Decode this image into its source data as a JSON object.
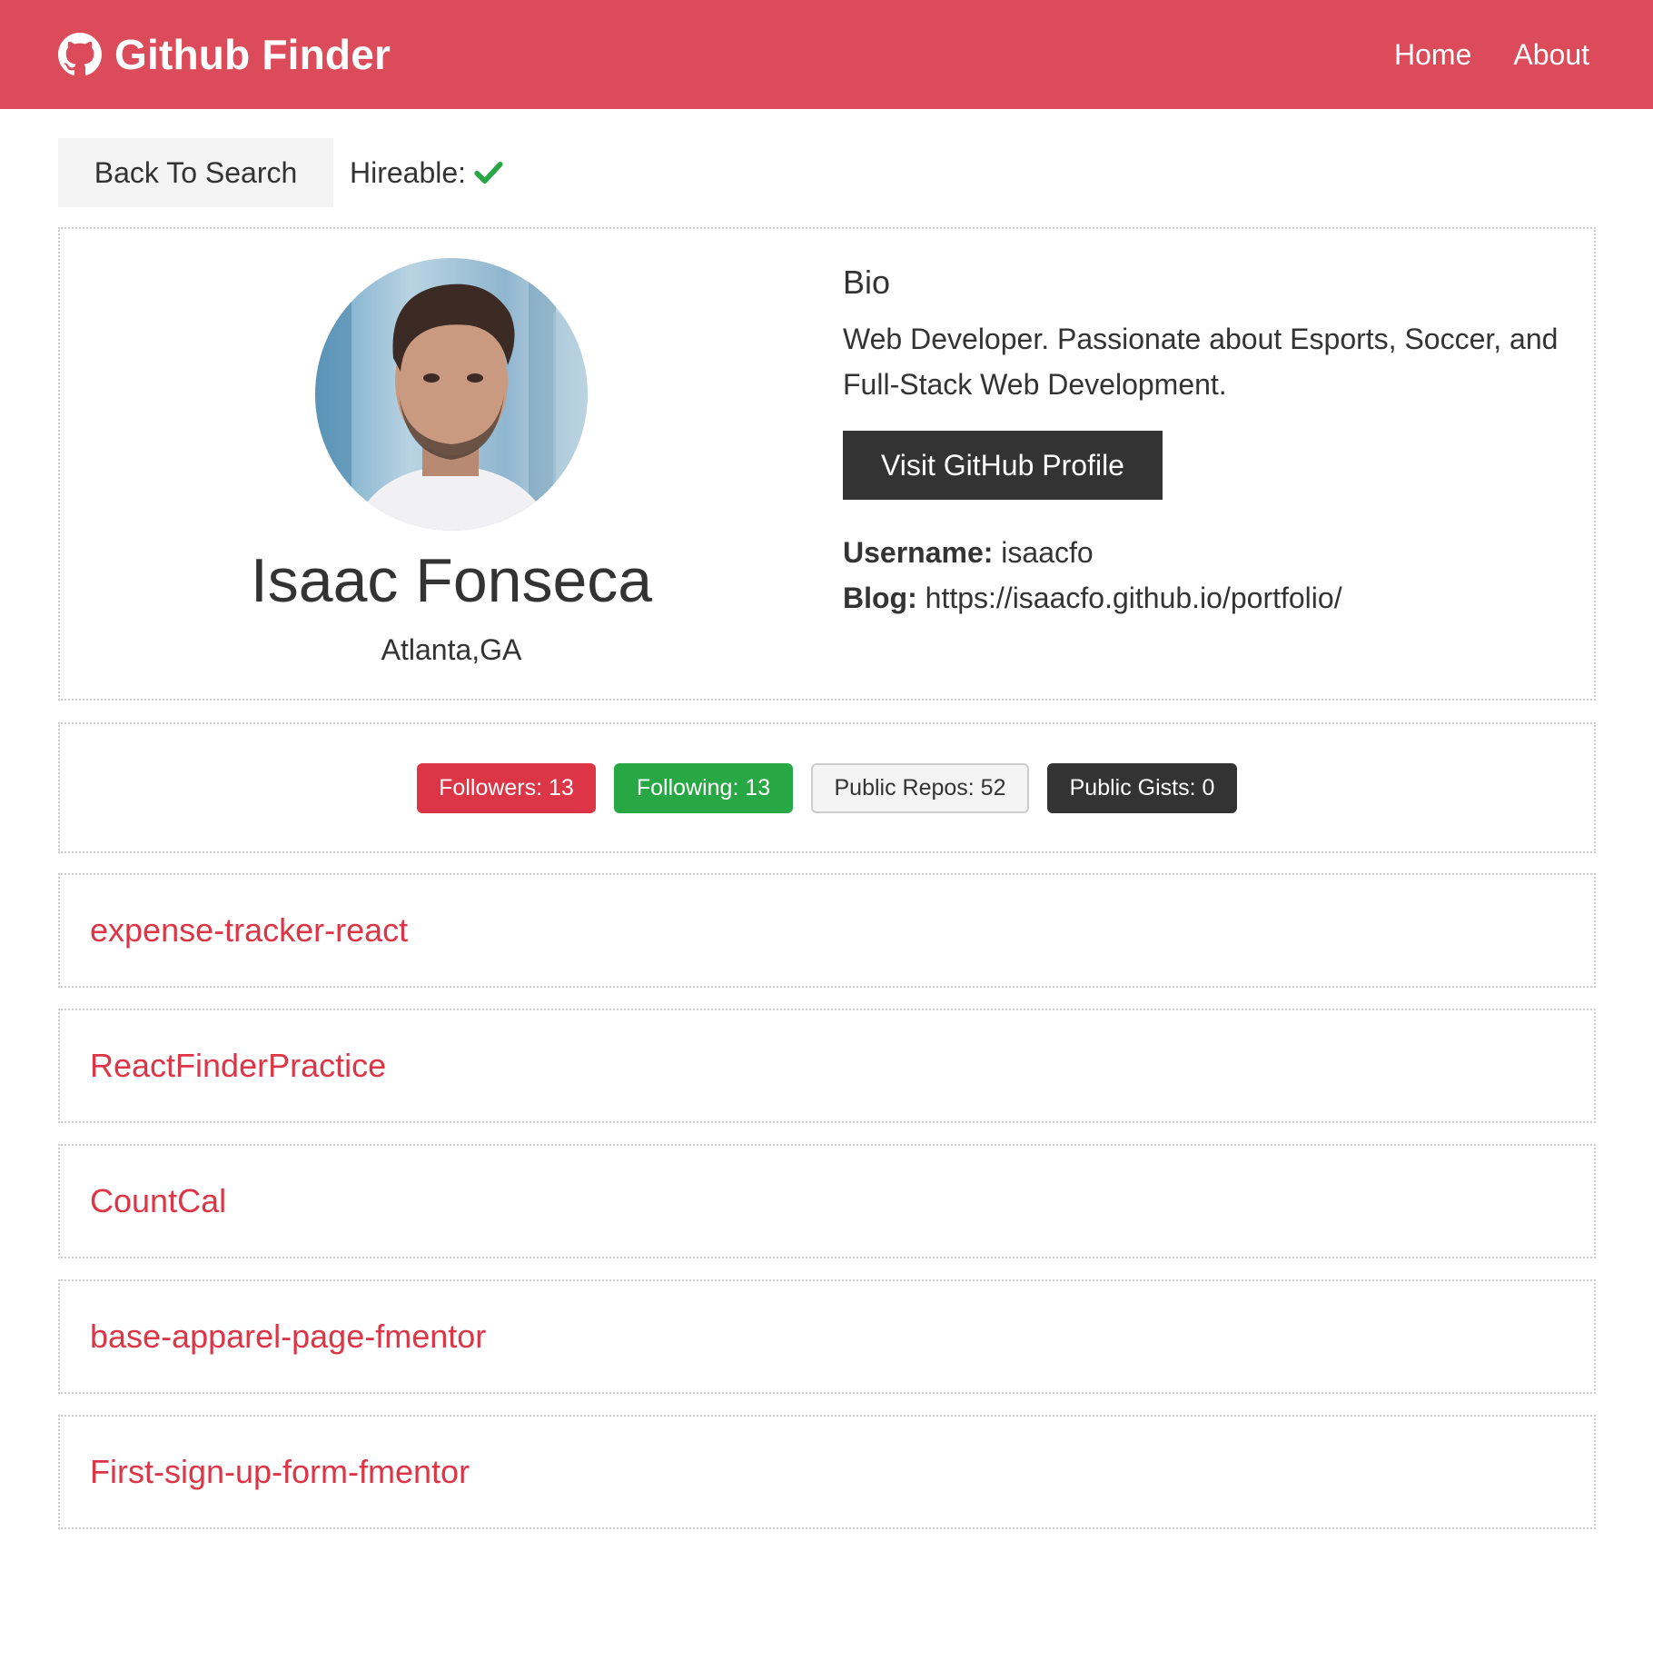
{
  "navbar": {
    "brand_icon": "github-icon",
    "title": "Github Finder",
    "links": [
      "Home",
      "About"
    ],
    "color": "#dc4b5a"
  },
  "actions": {
    "back_label": "Back To Search",
    "hireable_label": "Hireable:",
    "hireable_icon": "check-icon",
    "hireable_color": "#28a745"
  },
  "profile": {
    "name": "Isaac Fonseca",
    "location": "Atlanta,GA",
    "bio_heading": "Bio",
    "bio": "Web Developer. Passionate about Esports, Soccer, and Full-Stack Web Development.",
    "visit_label": "Visit GitHub Profile",
    "username_label": "Username:",
    "username": "isaacfo",
    "blog_label": "Blog:",
    "blog": "https://isaacfo.github.io/portfolio/"
  },
  "stats": {
    "followers": "Followers: 13",
    "following": "Following: 13",
    "public_repos": "Public Repos: 52",
    "public_gists": "Public Gists: 0"
  },
  "repos": [
    "expense-tracker-react",
    "ReactFinderPractice",
    "CountCal",
    "base-apparel-page-fmentor",
    "First-sign-up-form-fmentor"
  ]
}
